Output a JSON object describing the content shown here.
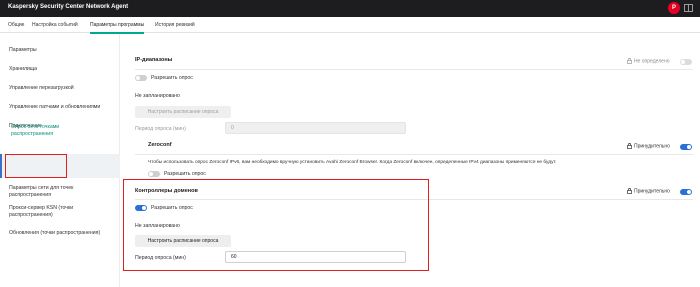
{
  "app": {
    "title": "Kaspersky Security Center Network Agent",
    "avatar_letter": "Р"
  },
  "tabs": [
    {
      "label": "Общие",
      "active": false
    },
    {
      "label": "Настройка событий",
      "active": false
    },
    {
      "label": "Параметры программы",
      "active": true
    },
    {
      "label": "История ревизий",
      "active": false
    }
  ],
  "sidebar": {
    "items": [
      {
        "label": "Параметры"
      },
      {
        "label": "Хранилища"
      },
      {
        "label": "Управление перезагрузкой"
      },
      {
        "label": "Управление патчами и обновлениями"
      },
      {
        "label": "Подключение"
      },
      {
        "label": "Опрос сети точками распространения",
        "active": true
      },
      {
        "label": "Параметры сети для точек распространения"
      },
      {
        "label": "Прокси-сервер KSN (точки распространения)"
      },
      {
        "label": "Обновления (точки распространения)"
      }
    ]
  },
  "sections": {
    "ip": {
      "title": "IP-диапазоны",
      "status": "Не определено",
      "toggle_label": "Разрешить опрос",
      "schedule_text": "Не запланировано",
      "schedule_button": "Настроить расписание опроса",
      "period_label": "Период опроса (мин)",
      "period_value": "0",
      "enabled": false
    },
    "zeroconf": {
      "title": "Zeroconf",
      "status": "Принудительно",
      "description": "Чтобы использовать опрос Zeroconf IPv6, вам необходимо вручную установить Avahi Zeroconf Browser. Когда Zeroconf включен, определенные IPv4 диапазоны применяются не будут.",
      "toggle_label": "Разрешить опрос",
      "enabled": false
    },
    "dc": {
      "title": "Контроллеры доменов",
      "status": "Принудительно",
      "toggle_label": "Разрешить опрос",
      "schedule_text": "Не запланировано",
      "schedule_button": "Настроить расписание опроса",
      "period_label": "Период опроса (мин)",
      "period_value": "60",
      "enabled": true
    }
  },
  "colors": {
    "accent": "#00a88e",
    "toggle_on": "#2a70d6",
    "highlight": "#e0201f",
    "titlebar": "#1d1d1f"
  }
}
